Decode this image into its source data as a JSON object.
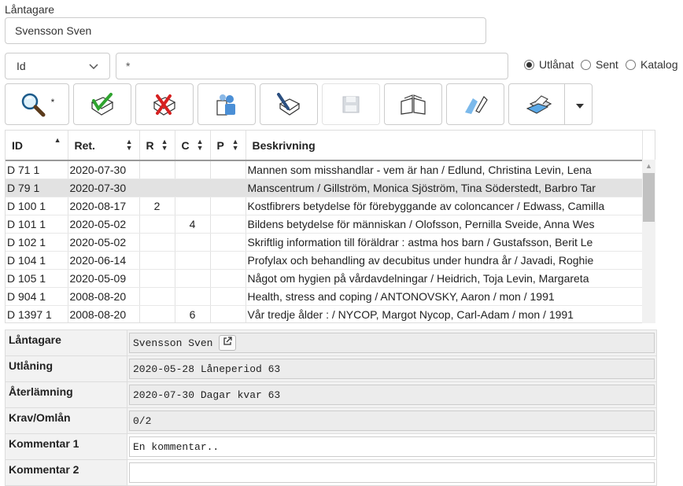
{
  "borrower": {
    "label": "Låntagare",
    "value": "Svensson Sven"
  },
  "search": {
    "field_selected": "Id",
    "term": "*"
  },
  "filters": {
    "options": [
      {
        "label": "Utlånat",
        "checked": true
      },
      {
        "label": "Sent",
        "checked": false
      },
      {
        "label": "Katalog",
        "checked": false
      }
    ]
  },
  "toolbar": {
    "search_suffix": "*",
    "buttons": [
      {
        "icon": "search-icon"
      },
      {
        "icon": "checkmark-book-icon"
      },
      {
        "icon": "x-book-icon"
      },
      {
        "icon": "users-icon"
      },
      {
        "icon": "pen-book-icon"
      },
      {
        "icon": "save-disk-icon"
      },
      {
        "icon": "open-book-icon"
      },
      {
        "icon": "eraser-icon"
      },
      {
        "icon": "print-icon"
      }
    ]
  },
  "table": {
    "columns": [
      "ID",
      "Ret.",
      "R",
      "C",
      "P",
      "Beskrivning"
    ],
    "rows": [
      {
        "id": "D 71 1",
        "ret": "2020-07-30",
        "r": "",
        "c": "",
        "p": "",
        "desc": "Mannen som misshandlar - vem är han / Edlund, Christina Levin, Lena"
      },
      {
        "id": "D 79 1",
        "ret": "2020-07-30",
        "r": "",
        "c": "",
        "p": "",
        "desc": "Manscentrum / Gillström, Monica Sjöström, Tina Söderstedt, Barbro Tar"
      },
      {
        "id": "D 100 1",
        "ret": "2020-08-17",
        "r": "2",
        "c": "",
        "p": "",
        "desc": "Kostfibrers betydelse för förebyggande av coloncancer / Edwass, Camilla"
      },
      {
        "id": "D 101 1",
        "ret": "2020-05-02",
        "r": "",
        "c": "4",
        "p": "",
        "desc": "Bildens betydelse för människan / Olofsson, Pernilla Sveide, Anna Wes"
      },
      {
        "id": "D 102 1",
        "ret": "2020-05-02",
        "r": "",
        "c": "",
        "p": "",
        "desc": "Skriftlig information till föräldrar : astma hos barn / Gustafsson, Berit Le"
      },
      {
        "id": "D 104 1",
        "ret": "2020-06-14",
        "r": "",
        "c": "",
        "p": "",
        "desc": "Profylax och behandling av decubitus under hundra år / Javadi, Roghie"
      },
      {
        "id": "D 105 1",
        "ret": "2020-05-09",
        "r": "",
        "c": "",
        "p": "",
        "desc": "Något om hygien på vårdavdelningar / Heidrich, Toja Levin, Margareta"
      },
      {
        "id": "D 904 1",
        "ret": "2008-08-20",
        "r": "",
        "c": "",
        "p": "",
        "desc": "Health, stress and coping / ANTONOVSKY, Aaron / mon / 1991"
      },
      {
        "id": "D 1397 1",
        "ret": "2008-08-20",
        "r": "",
        "c": "6",
        "p": "",
        "desc": "Vår tredje ålder : / NYCOP, Margot Nycop, Carl-Adam / mon / 1991"
      }
    ]
  },
  "details": {
    "borrower_label": "Låntagare",
    "borrower_value": "Svensson Sven",
    "loan_label": "Utlåning",
    "loan_value": "2020-05-28 Låneperiod 63",
    "return_label": "Återlämning",
    "return_value": "2020-07-30 Dagar kvar 63",
    "claims_label": "Krav/Omlån",
    "claims_value": "0/2",
    "comment1_label": "Kommentar 1",
    "comment1_value": "En kommentar..",
    "comment2_label": "Kommentar 2",
    "comment2_value": ""
  }
}
